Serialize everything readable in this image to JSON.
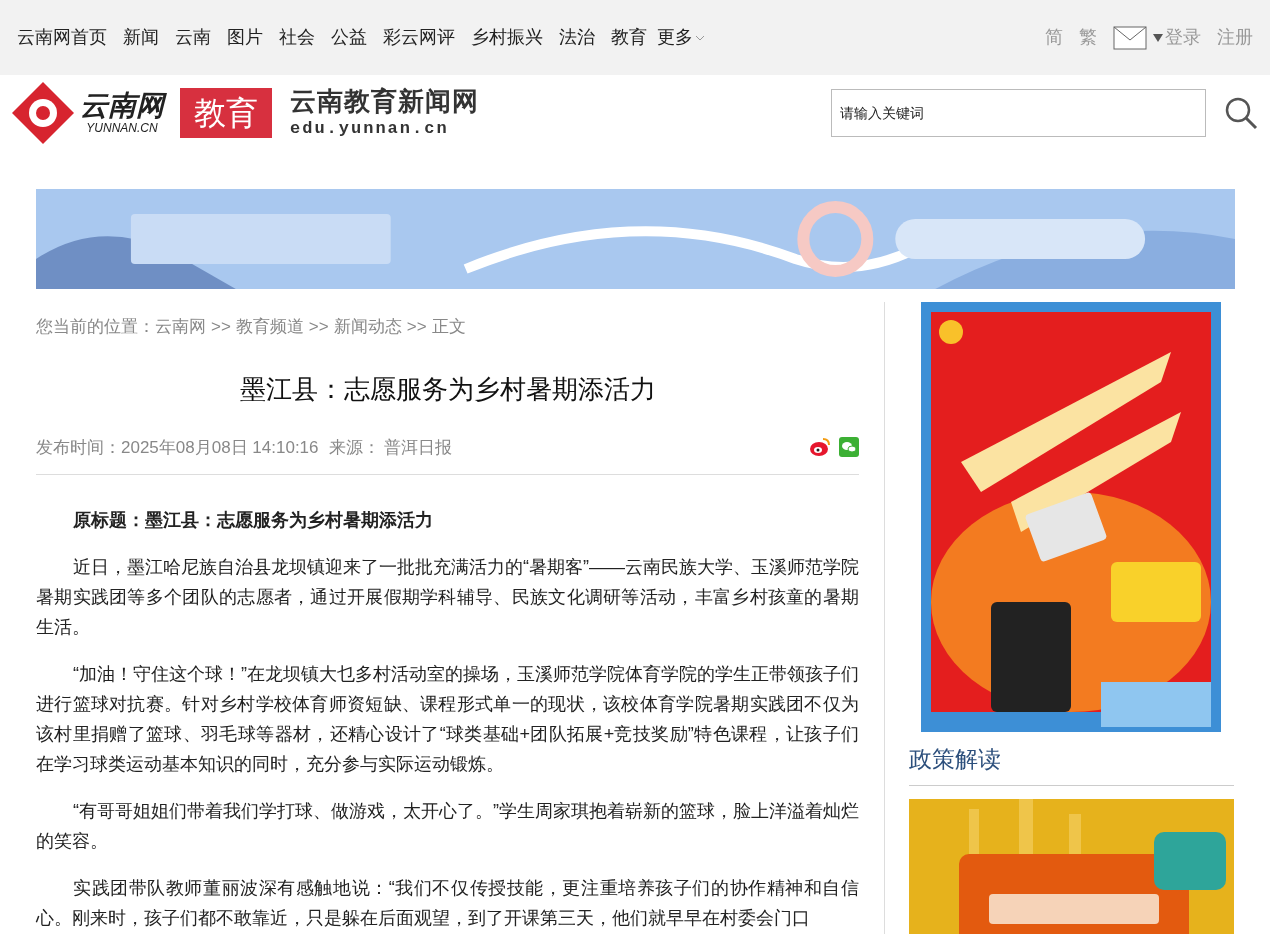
{
  "top_nav": {
    "links": [
      "云南网首页",
      "新闻",
      "云南",
      "图片",
      "社会",
      "公益",
      "彩云网评",
      "乡村振兴",
      "法治",
      "教育"
    ],
    "more": "更多",
    "right": {
      "simplified": "简",
      "traditional": "繁",
      "login": "登录",
      "register": "注册"
    }
  },
  "header": {
    "logo": {
      "name": "云南网",
      "domain": "YUNNAN.CN"
    },
    "channel": "教育",
    "site_name": "云南教育新闻网",
    "site_url": "edu.yunnan.cn",
    "search": {
      "placeholder": "请输入关键词"
    }
  },
  "breadcrumb": {
    "prefix": "您当前的位置：",
    "items": [
      "云南网",
      ">>",
      "教育频道",
      ">>",
      "新闻动态",
      ">>",
      "正文"
    ]
  },
  "article": {
    "title": "墨江县：志愿服务为乡村暑期添活力",
    "publish_time": "发布时间：2025年08月08日 14:10:16",
    "source": "来源： 普洱日报",
    "paragraphs": [
      {
        "kind": "subtitle",
        "text": "原标题：墨江县：志愿服务为乡村暑期添活力"
      },
      {
        "kind": "body",
        "text": "近日，墨江哈尼族自治县龙坝镇迎来了一批批充满活力的“暑期客”——云南民族大学、玉溪师范学院暑期实践团等多个团队的志愿者，通过开展假期学科辅导、民族文化调研等活动，丰富乡村孩童的暑期生活。"
      },
      {
        "kind": "body",
        "text": "“加油！守住这个球！”在龙坝镇大乜多村活动室的操场，玉溪师范学院体育学院的学生正带领孩子们进行篮球对抗赛。针对乡村学校体育师资短缺、课程形式单一的现状，该校体育学院暑期实践团不仅为该村里捐赠了篮球、羽毛球等器材，还精心设计了“球类基础+团队拓展+竞技奖励”特色课程，让孩子们在学习球类运动基本知识的同时，充分参与实际运动锻炼。"
      },
      {
        "kind": "body",
        "text": "“有哥哥姐姐们带着我们学打球、做游戏，太开心了。”学生周家琪抱着崭新的篮球，脸上洋溢着灿烂的笑容。"
      },
      {
        "kind": "body",
        "text": "实践团带队教师董丽波深有感触地说：“我们不仅传授技能，更注重培养孩子们的协作精神和自信心。刚来时，孩子们都不敢靠近，只是躲在后面观望，到了开课第三天，他们就早早在村委会门口"
      }
    ]
  },
  "sidebar": {
    "section_title": "政策解读"
  }
}
